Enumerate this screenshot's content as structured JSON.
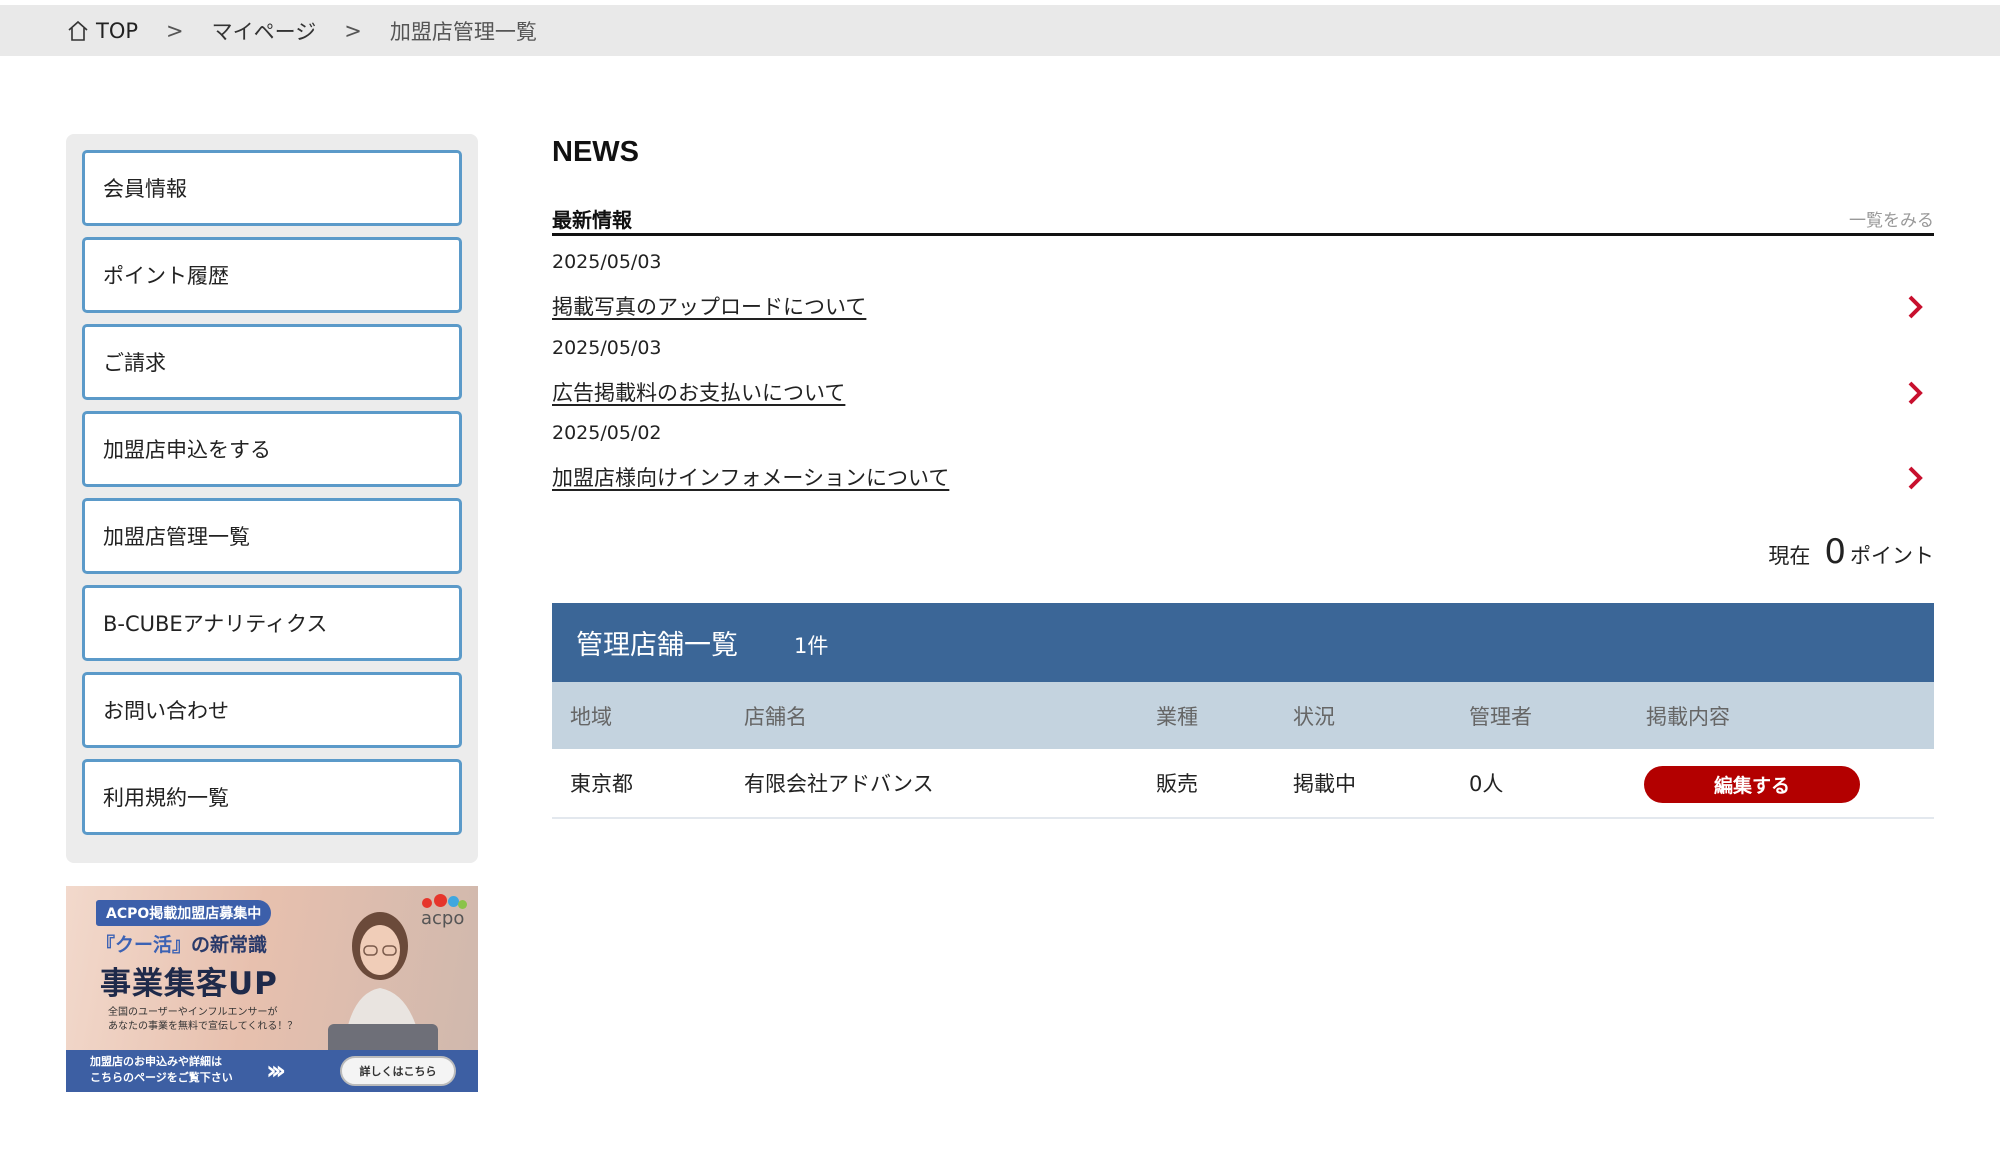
{
  "breadcrumb": {
    "home": "TOP",
    "separator": ">",
    "mypage": "マイページ",
    "current": "加盟店管理一覧"
  },
  "sidebar": {
    "items": [
      {
        "label": "会員情報"
      },
      {
        "label": "ポイント履歴"
      },
      {
        "label": "ご請求"
      },
      {
        "label": "加盟店申込をする"
      },
      {
        "label": "加盟店管理一覧"
      },
      {
        "label": "B-CUBEアナリティクス"
      },
      {
        "label": "お問い合わせ"
      },
      {
        "label": "利用規約一覧"
      }
    ]
  },
  "banner": {
    "tag": "ACPO掲載加盟店募集中",
    "logo_text": "acpo",
    "line1_highlight": "『クー活』",
    "line1_rest": "の新常識",
    "line2": "事業集客UP",
    "small_1": "全国のユーザーやインフルエンサーが",
    "small_2": "あなたの事業を無料で宣伝してくれる！？",
    "bottom_1": "加盟店のお申込みや詳細は",
    "bottom_2": "こちらのページをご覧下さい",
    "arrows": "›››",
    "button": "詳しくはこちら"
  },
  "news": {
    "title": "NEWS",
    "subtitle": "最新情報",
    "view_all": "一覧をみる",
    "items": [
      {
        "date": "2025/05/03",
        "title": "掲載写真のアップロードについて"
      },
      {
        "date": "2025/05/03",
        "title": "広告掲載料のお支払いについて"
      },
      {
        "date": "2025/05/02",
        "title": "加盟店様向けインフォメーションについて"
      }
    ]
  },
  "points": {
    "prefix": "現在",
    "value": "0",
    "suffix": "ポイント"
  },
  "stores": {
    "title": "管理店舗一覧",
    "count": "1件",
    "columns": [
      "地域",
      "店舗名",
      "業種",
      "状況",
      "管理者",
      "掲載内容"
    ],
    "rows": [
      {
        "region": "東京都",
        "name": "有限会社アドバンス",
        "industry": "販売",
        "status": "掲載中",
        "admins": "0人",
        "action": "編集する"
      }
    ]
  },
  "colors": {
    "accent_blue": "#3b6697",
    "header_row": "#c4d3df",
    "sidebar_border": "#5b9ac9",
    "edit_button": "#b30000",
    "chevron": "#c8102e"
  }
}
